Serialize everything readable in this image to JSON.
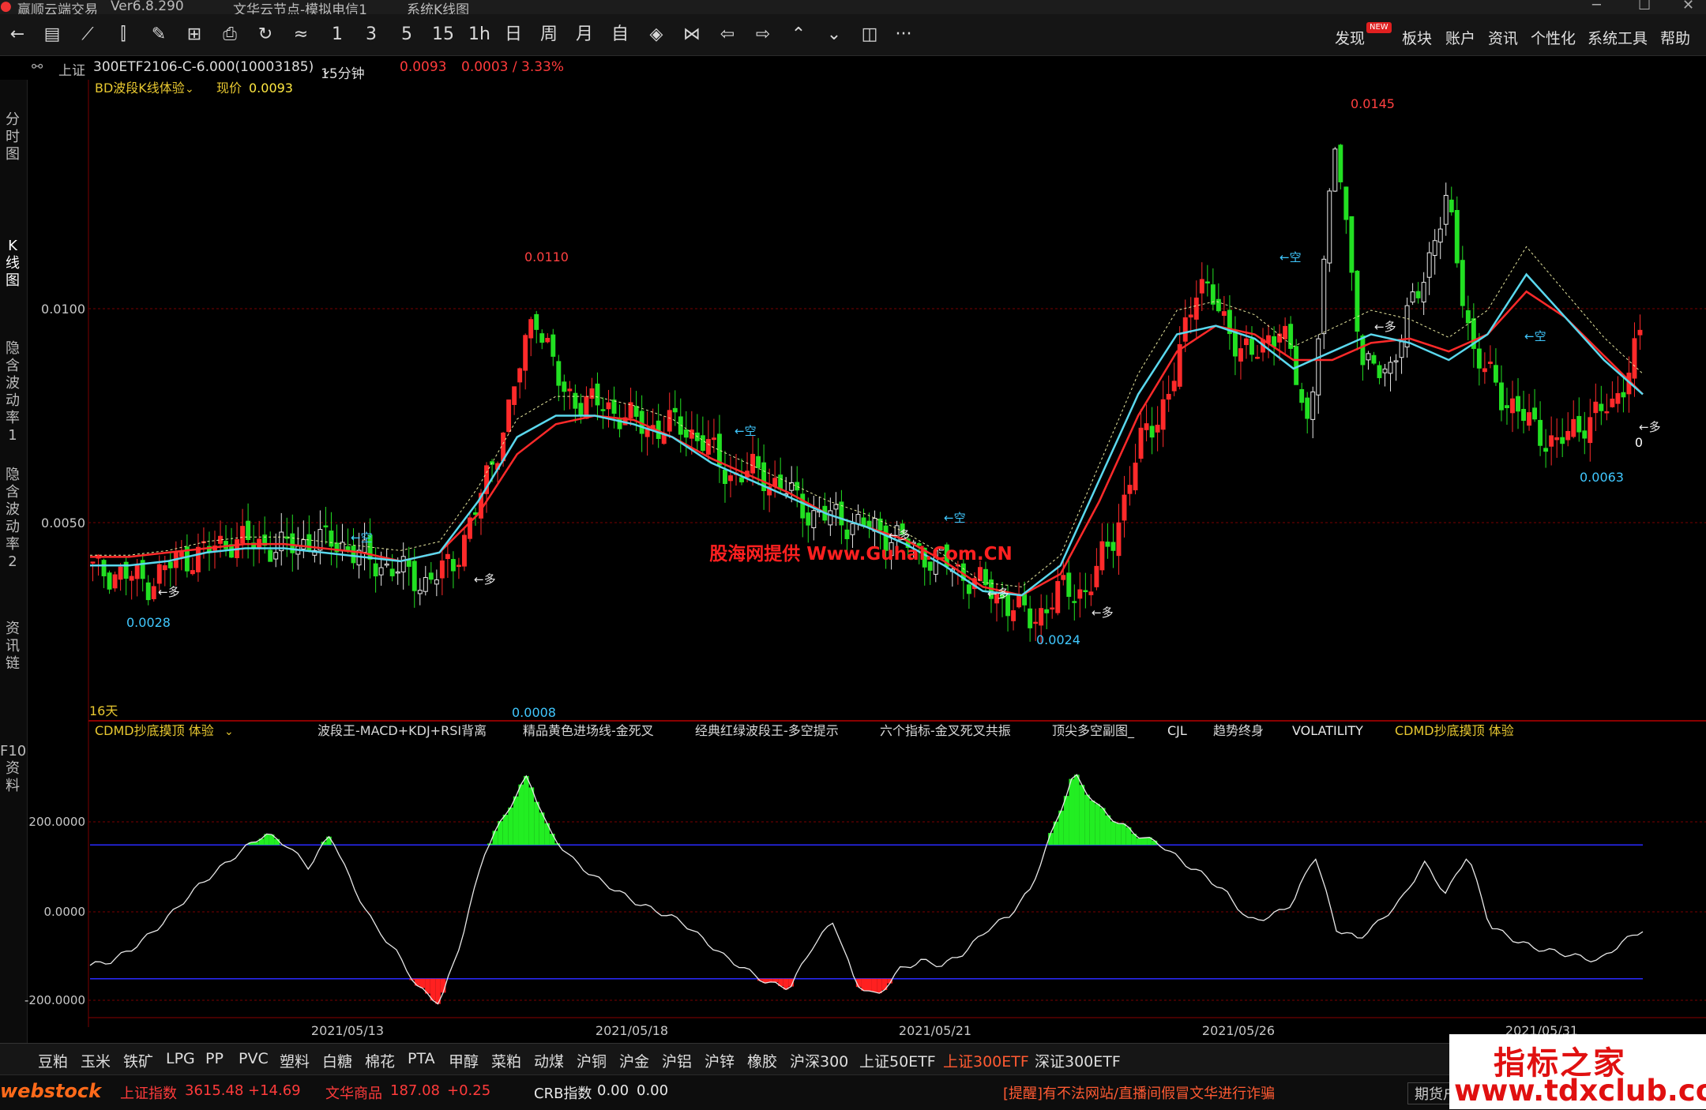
{
  "window": {
    "app_title": "赢顺云端交易",
    "version": "Ver6.8.290",
    "server": "文华云节点-模拟电信1",
    "view_title": "系统K线图"
  },
  "toolbar": {
    "icons": [
      "back-icon",
      "list-icon",
      "line-chart-icon",
      "candlestick-icon",
      "draw-icon",
      "grid-icon",
      "save-icon",
      "refresh-icon",
      "compare-icon"
    ],
    "periods": [
      "1",
      "3",
      "5",
      "15",
      "1h",
      "日",
      "周",
      "月",
      "自"
    ],
    "nav_icons": [
      "expand-icon",
      "shrink-icon",
      "arrow-left-icon",
      "arrow-right-icon",
      "arrow-up-icon",
      "arrow-down-icon",
      "layout-icon",
      "more-icon"
    ],
    "more_label": "···",
    "menu": [
      "发现",
      "板块",
      "账户",
      "资讯",
      "个性化",
      "系统工具",
      "帮助"
    ],
    "new_badge": "NEW"
  },
  "infobar": {
    "exchange": "上证",
    "contract": "300ETF2106-C-6.000(10003185)",
    "period": "15分钟",
    "price": "0.0093",
    "change": "0.0003 / 3.33%"
  },
  "sidebar": {
    "tabs": [
      "分\n时\n图",
      "K\n线\n图",
      "隐\n含\n波\n动\n率\n1",
      "隐\n含\n波\n动\n率\n2",
      "资\n讯\n链",
      "F10\n资\n料"
    ]
  },
  "main_chart": {
    "indicator_name": "BD波段K线体验",
    "price_label": "现价",
    "price_value": "0.0093",
    "y_ticks": [
      "0.0100",
      "0.0050"
    ],
    "annotations": {
      "high1": "0.0110",
      "high2": "0.0145",
      "low1": "0.0028",
      "low2": "0.0008",
      "low3": "0.0024",
      "low4": "0.0063",
      "zero": "0"
    },
    "markers": {
      "long": "←多",
      "short": "←空"
    },
    "days": "16天",
    "watermark": "股海网提供 Www.Guhai.Com.CN"
  },
  "sub_chart": {
    "indicator_name": "CDMD抄底摸顶 体验",
    "tabs": [
      "波段王-MACD+KDJ+RSI背离",
      "精品黄色进场线-金死叉",
      "经典红绿波段王-多空提示",
      "六个指标-金叉死叉共振",
      "顶尖多空副图_",
      "CJL",
      "趋势终身",
      "VOLATILITY",
      "CDMD抄底摸顶 体验"
    ],
    "y_ticks": [
      "200.0000",
      "0.0000",
      "-200.0000"
    ]
  },
  "x_axis": {
    "dates": [
      "2021/05/13",
      "2021/05/18",
      "2021/05/21",
      "2021/05/26",
      "2021/05/31"
    ]
  },
  "bottom_tabs": {
    "items": [
      "豆粕",
      "玉米",
      "铁矿",
      "LPG",
      "PP",
      "PVC",
      "塑料",
      "白糖",
      "棉花",
      "PTA",
      "甲醇",
      "菜粕",
      "动煤",
      "沪铜",
      "沪金",
      "沪铝",
      "沪锌",
      "橡胶",
      "沪深300",
      "上证50ETF",
      "上证300ETF",
      "深证300ETF"
    ],
    "active": "上证300ETF"
  },
  "statusbar": {
    "logo": "webstock",
    "index1_name": "上证指数",
    "index1_value": "3615.48",
    "index1_change": "+14.69",
    "index2_name": "文华商品",
    "index2_value": "187.08",
    "index2_change": "+0.25",
    "index3_name": "CRB指数",
    "index3_value": "0.00",
    "index3_change": "0.00",
    "notice": "[提醒]有不法网站/直播间假冒文华进行诈骗",
    "futures_btn": "期货户"
  },
  "branding": {
    "line1": "指标之家",
    "line2": "www.tdxclub.com"
  },
  "chart_data": {
    "type": "candlestick",
    "price_path": [
      0.0039,
      0.0038,
      0.0036,
      0.0041,
      0.0043,
      0.0046,
      0.0045,
      0.0044,
      0.0046,
      0.0045,
      0.0041,
      0.0039,
      0.0036,
      0.004,
      0.0055,
      0.0075,
      0.01,
      0.008,
      0.0078,
      0.0076,
      0.0072,
      0.0073,
      0.007,
      0.0061,
      0.0062,
      0.0058,
      0.0052,
      0.0051,
      0.0049,
      0.0047,
      0.0043,
      0.004,
      0.0036,
      0.0032,
      0.0027,
      0.0034,
      0.0034,
      0.0048,
      0.007,
      0.008,
      0.0108,
      0.0096,
      0.0088,
      0.0097,
      0.0072,
      0.014,
      0.0085,
      0.0087,
      0.0105,
      0.0125,
      0.0089,
      0.008,
      0.0073,
      0.0068,
      0.0074,
      0.0077,
      0.0093
    ],
    "ma_fast": [
      0.004,
      0.004,
      0.0041,
      0.0043,
      0.0044,
      0.0044,
      0.0043,
      0.0042,
      0.0041,
      0.0043,
      0.0055,
      0.007,
      0.0075,
      0.0075,
      0.0073,
      0.007,
      0.0064,
      0.006,
      0.0056,
      0.0052,
      0.0049,
      0.0045,
      0.004,
      0.0034,
      0.0033,
      0.004,
      0.006,
      0.008,
      0.0094,
      0.0096,
      0.0093,
      0.0086,
      0.009,
      0.0094,
      0.0092,
      0.0088,
      0.0094,
      0.0108,
      0.0098,
      0.0088,
      0.008
    ],
    "ma_slow": [
      0.0042,
      0.0042,
      0.0043,
      0.0044,
      0.0045,
      0.0045,
      0.0044,
      0.0043,
      0.0041,
      0.0043,
      0.0052,
      0.0066,
      0.0073,
      0.0075,
      0.0074,
      0.007,
      0.0065,
      0.0061,
      0.0057,
      0.0052,
      0.0049,
      0.0046,
      0.0041,
      0.0035,
      0.0033,
      0.0038,
      0.0055,
      0.0075,
      0.009,
      0.0096,
      0.0094,
      0.0088,
      0.0088,
      0.0092,
      0.0093,
      0.009,
      0.0094,
      0.0104,
      0.0098,
      0.0089,
      0.008
    ],
    "ylim": [
      0.0008,
      0.0145
    ],
    "oscillator": {
      "values": [
        -120,
        -110,
        -80,
        -40,
        10,
        60,
        100,
        140,
        175,
        150,
        100,
        175,
        60,
        -30,
        -90,
        -170,
        -205,
        -60,
        130,
        220,
        305,
        180,
        120,
        80,
        50,
        20,
        0,
        -20,
        -60,
        -100,
        -130,
        -160,
        -170,
        -80,
        -20,
        -160,
        -190,
        -130,
        -110,
        -120,
        -90,
        -40,
        -10,
        50,
        180,
        310,
        240,
        200,
        170,
        150,
        110,
        80,
        40,
        -20,
        -10,
        20,
        130,
        -40,
        -60,
        -20,
        30,
        110,
        40,
        130,
        -30,
        -60,
        -80,
        -90,
        -100,
        -110,
        -70,
        -40
      ],
      "threshold_upper": 150,
      "threshold_lower": -150,
      "ylim": [
        -220,
        320
      ]
    }
  }
}
